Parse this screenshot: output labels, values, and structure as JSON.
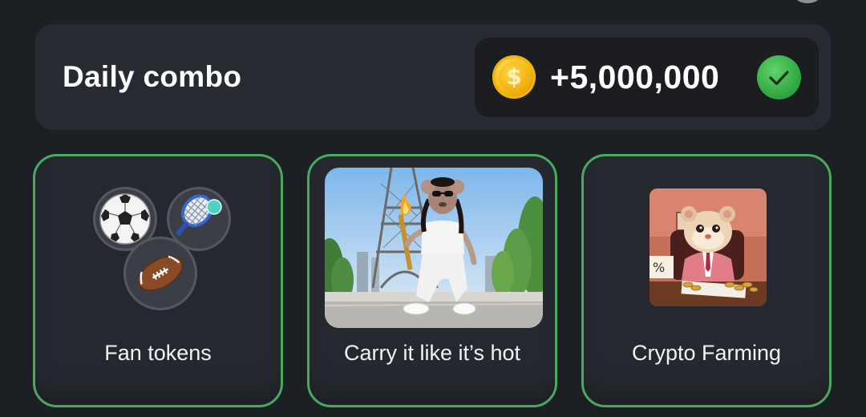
{
  "daily_combo": {
    "title": "Daily combo",
    "reward": "+5,000,000",
    "coin_symbol": "$",
    "completed": true
  },
  "cards": [
    {
      "label": "Fan tokens",
      "icon": "sports-balls-icon"
    },
    {
      "label": "Carry it like it’s hot",
      "icon": "torch-mouse-paris-image"
    },
    {
      "label": "Crypto Farming",
      "icon": "hamster-banker-image"
    }
  ],
  "colors": {
    "background": "#1c1f24",
    "panel": "#272a30",
    "card_border": "#4ba861",
    "check_green": "#2ea43e",
    "coin_gold": "#f7c21a"
  }
}
